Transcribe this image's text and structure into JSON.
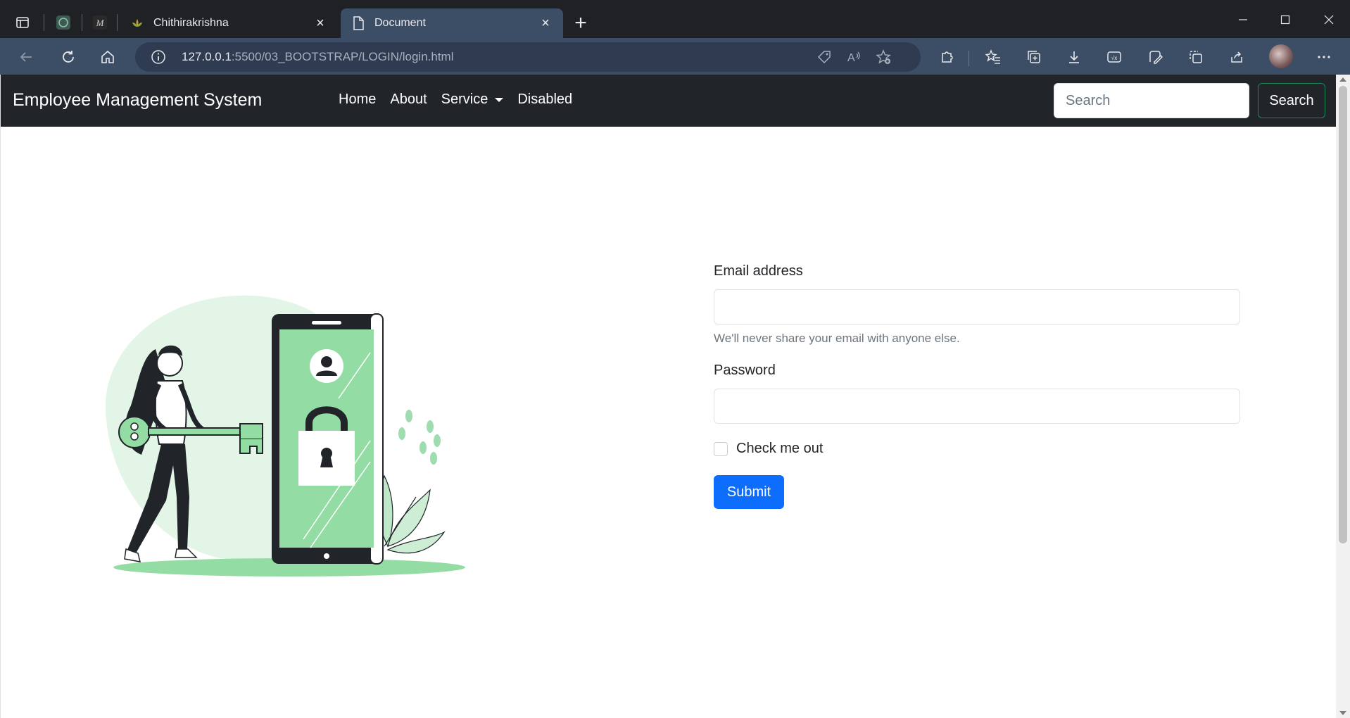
{
  "browser": {
    "tabs": [
      {
        "title": "Chithirakrishna",
        "active": false
      },
      {
        "title": "Document",
        "active": true
      }
    ],
    "address": {
      "host": "127.0.0.1",
      "rest": ":5500/03_BOOTSTRAP/LOGIN/login.html"
    },
    "icons": [
      "tab-actions-icon",
      "chatgpt-icon",
      "m-icon",
      "back-icon",
      "refresh-icon",
      "home-icon",
      "info-icon",
      "tag-icon",
      "read-aloud-icon",
      "add-favorite-icon",
      "extensions-icon",
      "favorites-icon",
      "collections-icon",
      "downloads-icon",
      "math-solver-icon",
      "copilot-icon",
      "screenshot-icon",
      "share-icon",
      "profile-avatar",
      "more-icon"
    ]
  },
  "navbar": {
    "brand": "Employee Management System",
    "links": [
      "Home",
      "About",
      "Service",
      "Disabled"
    ],
    "search_placeholder": "Search",
    "search_button": "Search"
  },
  "form": {
    "email_label": "Email address",
    "email_help": "We'll never share your email with anyone else.",
    "password_label": "Password",
    "check_label": "Check me out",
    "submit_label": "Submit"
  },
  "colors": {
    "navbar_bg": "#212529",
    "primary": "#0d6efd",
    "success_outline": "#198754",
    "illustration_green": "#93dca4"
  }
}
